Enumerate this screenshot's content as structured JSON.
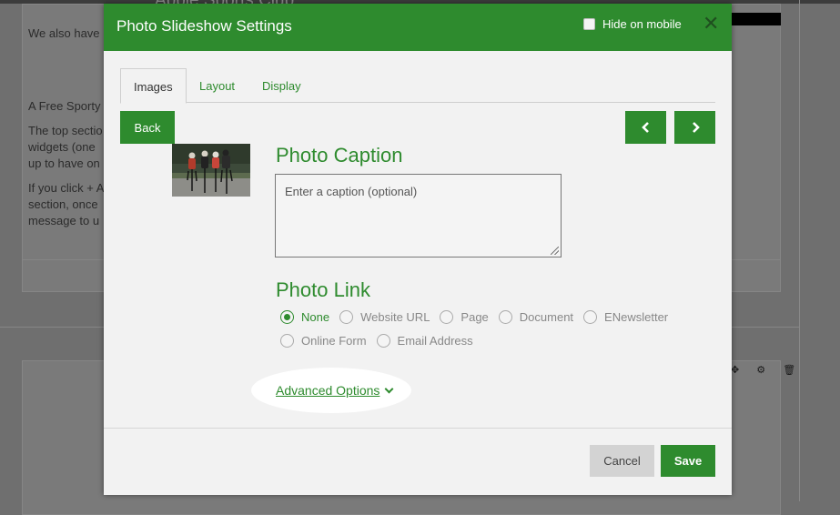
{
  "background": {
    "site_title": "Abbie Sports Club",
    "paragraph_lines": [
      "We also have",
      "A Free Sporty",
      "The top sectio",
      "widgets (one",
      "up to have on",
      "If you click + A",
      "section, once",
      "message to u"
    ],
    "toolbar_glyphs": "✥ ⚙ 🗑"
  },
  "modal": {
    "title": "Photo Slideshow Settings",
    "hide_on_mobile": {
      "label": "Hide on mobile",
      "checked": false
    },
    "tabs": [
      {
        "label": "Images",
        "active": true
      },
      {
        "label": "Layout",
        "active": false
      },
      {
        "label": "Display",
        "active": false
      }
    ],
    "back_label": "Back",
    "caption": {
      "heading": "Photo Caption",
      "placeholder": "Enter a caption (optional)",
      "value": ""
    },
    "photo_link": {
      "heading": "Photo Link",
      "options": [
        {
          "label": "None",
          "selected": true
        },
        {
          "label": "Website URL",
          "selected": false
        },
        {
          "label": "Page",
          "selected": false
        },
        {
          "label": "Document",
          "selected": false
        },
        {
          "label": "ENewsletter",
          "selected": false
        },
        {
          "label": "Online Form",
          "selected": false
        },
        {
          "label": "Email Address",
          "selected": false
        }
      ]
    },
    "advanced_options_label": "Advanced Options",
    "cancel_label": "Cancel",
    "save_label": "Save"
  },
  "colors": {
    "brand_green": "#2e8b2e",
    "overlay_gray": "#6f6f6f",
    "cancel_gray": "#d3d3d3"
  },
  "icons": {
    "close": "close-icon",
    "prev": "chevron-left-icon",
    "next": "chevron-right-icon",
    "advanced": "chevron-down-icon"
  }
}
